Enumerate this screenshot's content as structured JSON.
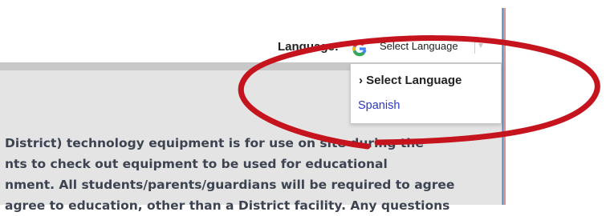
{
  "header": {
    "language_label": "Language:",
    "language_select": {
      "value": "Select Language",
      "icon": "google-g-icon"
    }
  },
  "dropdown": {
    "items": [
      {
        "label": "› Select Language",
        "selected": true
      },
      {
        "label": "Spanish",
        "selected": false
      }
    ]
  },
  "content": {
    "lines": [
      "District) technology equipment is for use on site during the",
      "nts to check out equipment to be used for educational",
      "nment. All students/parents/guardians will be required to agree",
      "  agree to education, other than a District facility. Any questions"
    ]
  },
  "colors": {
    "annotation_red": "#c5141e",
    "link_blue": "#2b38c6",
    "panel_gray": "#e4e4e4"
  }
}
